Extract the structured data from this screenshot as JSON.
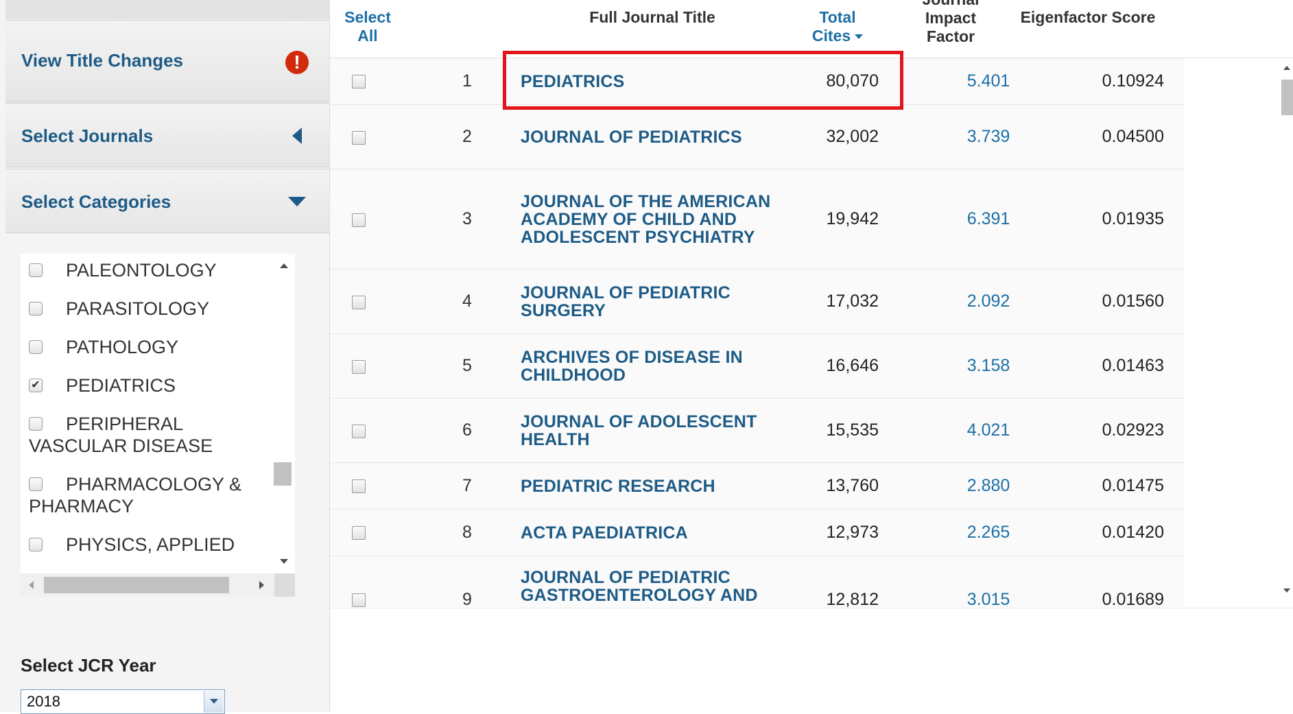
{
  "sidebar": {
    "view_title_changes": "View Title Changes",
    "select_journals": "Select Journals",
    "select_categories": "Select Categories",
    "alert_icon": "exclamation-icon",
    "categories": [
      {
        "label": "PALEONTOLOGY",
        "checked": false
      },
      {
        "label": "PARASITOLOGY",
        "checked": false
      },
      {
        "label": "PATHOLOGY",
        "checked": false
      },
      {
        "label": "PEDIATRICS",
        "checked": true
      },
      {
        "label": "PERIPHERAL VASCULAR DISEASE",
        "checked": false
      },
      {
        "label": "PHARMACOLOGY & PHARMACY",
        "checked": false
      },
      {
        "label": "PHYSICS, APPLIED",
        "checked": false
      }
    ],
    "select_jcr_year": "Select JCR Year",
    "year_value": "2018"
  },
  "table": {
    "headers": {
      "select": "Select",
      "all": "All",
      "title": "Full Journal Title",
      "total": "Total",
      "cites": "Cites",
      "jif_top": "Journal",
      "jif_mid": "Impact",
      "jif_bot": "Factor",
      "eigen": "Eigenfactor Score"
    },
    "rows": [
      {
        "rank": "1",
        "title": "PEDIATRICS",
        "cites": "80,070",
        "jif": "5.401",
        "eigen": "0.10924"
      },
      {
        "rank": "2",
        "title": "JOURNAL OF PEDIATRICS",
        "cites": "32,002",
        "jif": "3.739",
        "eigen": "0.04500"
      },
      {
        "rank": "3",
        "title": "JOURNAL OF THE AMERICAN ACADEMY OF CHILD AND ADOLESCENT PSYCHIATRY",
        "cites": "19,942",
        "jif": "6.391",
        "eigen": "0.01935"
      },
      {
        "rank": "4",
        "title": "JOURNAL OF PEDIATRIC SURGERY",
        "cites": "17,032",
        "jif": "2.092",
        "eigen": "0.01560"
      },
      {
        "rank": "5",
        "title": "ARCHIVES OF DISEASE IN CHILDHOOD",
        "cites": "16,646",
        "jif": "3.158",
        "eigen": "0.01463"
      },
      {
        "rank": "6",
        "title": "JOURNAL OF ADOLESCENT HEALTH",
        "cites": "15,535",
        "jif": "4.021",
        "eigen": "0.02923"
      },
      {
        "rank": "7",
        "title": "PEDIATRIC RESEARCH",
        "cites": "13,760",
        "jif": "2.880",
        "eigen": "0.01475"
      },
      {
        "rank": "8",
        "title": "ACTA PAEDIATRICA",
        "cites": "12,973",
        "jif": "2.265",
        "eigen": "0.01420"
      },
      {
        "rank": "9",
        "title": "JOURNAL OF PEDIATRIC GASTROENTEROLOGY AND",
        "cites": "12,812",
        "jif": "3.015",
        "eigen": "0.01689"
      }
    ]
  },
  "colors": {
    "link": "#1d5b86",
    "highlight": "#e3141b",
    "alert": "#d22a0d"
  }
}
